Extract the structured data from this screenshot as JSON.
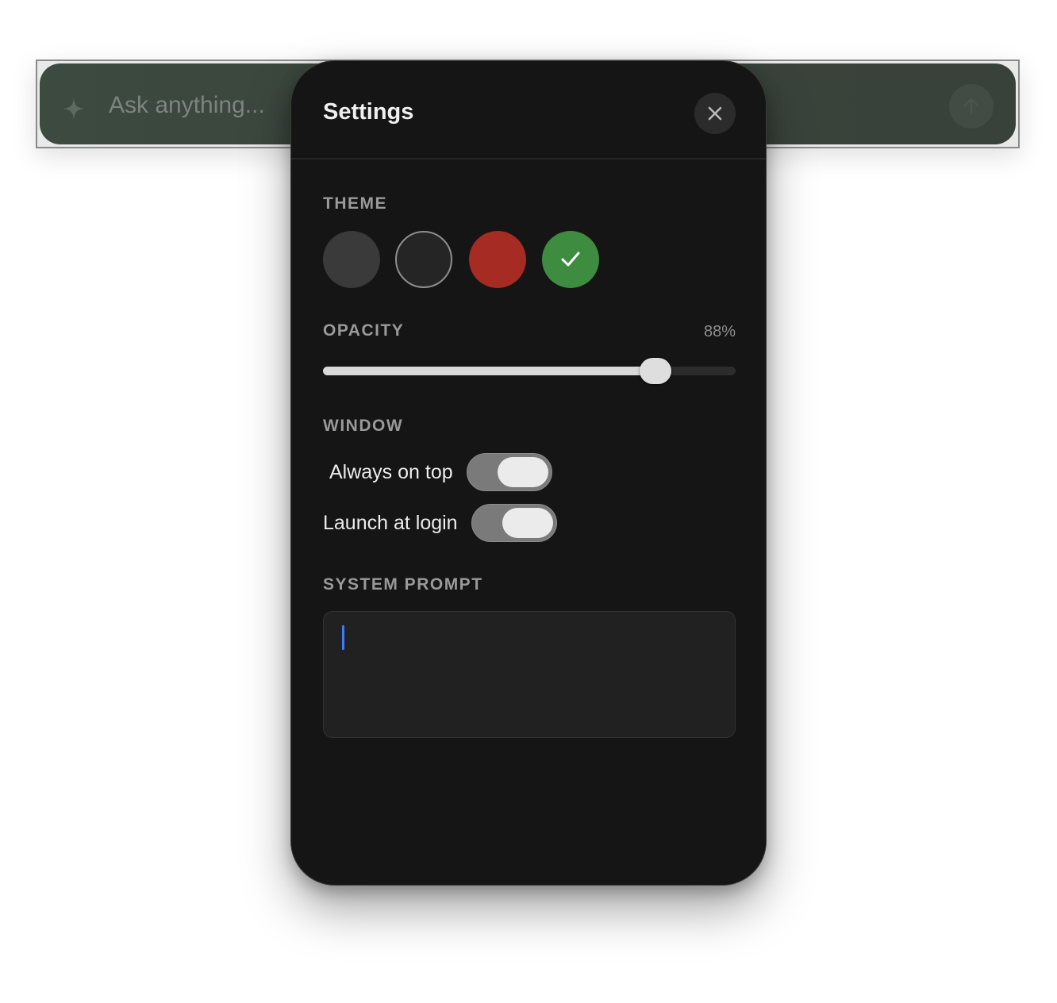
{
  "askbar": {
    "placeholder": "Ask anything...",
    "sparkle_icon": "sparkle-icon",
    "send_icon": "arrow-up-icon"
  },
  "settings": {
    "title": "Settings",
    "close_icon": "close-icon",
    "theme": {
      "label": "THEME",
      "swatches": [
        {
          "name": "charcoal",
          "color": "#3a3a3a",
          "selected": false
        },
        {
          "name": "dark-outline",
          "color": "#252525",
          "selected": false
        },
        {
          "name": "red",
          "color": "#a52b23",
          "selected": false
        },
        {
          "name": "green",
          "color": "#3e8c3f",
          "selected": true
        }
      ],
      "selected_icon": "checkmark-icon"
    },
    "opacity": {
      "label": "OPACITY",
      "value_text": "88%",
      "fraction": 0.805
    },
    "window": {
      "label": "WINDOW",
      "always_on_top": {
        "label": "Always on top",
        "on": true
      },
      "launch_at_login": {
        "label": "Launch at login",
        "on": true
      }
    },
    "system_prompt": {
      "label": "SYSTEM PROMPT",
      "value": ""
    }
  }
}
